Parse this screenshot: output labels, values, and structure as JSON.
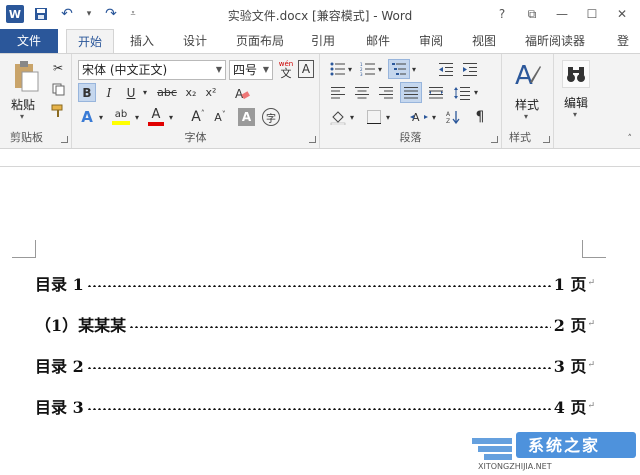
{
  "window": {
    "title": "实验文件.docx [兼容模式] - Word",
    "app_icon": "W",
    "help": "?",
    "restore": "⧉",
    "minimize": "—",
    "maximize": "☐",
    "close": "✕"
  },
  "tabs": [
    {
      "label": "文件"
    },
    {
      "label": "开始"
    },
    {
      "label": "插入"
    },
    {
      "label": "设计"
    },
    {
      "label": "页面布局"
    },
    {
      "label": "引用"
    },
    {
      "label": "邮件"
    },
    {
      "label": "审阅"
    },
    {
      "label": "视图"
    },
    {
      "label": "福昕阅读器"
    },
    {
      "label": "登"
    }
  ],
  "ribbon": {
    "clipboard": {
      "label": "剪贴板",
      "paste": "粘贴"
    },
    "font": {
      "label": "字体",
      "font_name": "宋体 (中文正文)",
      "font_size": "四号",
      "wen": "wén",
      "wen_char": "文",
      "bold": "B",
      "italic": "I",
      "underline": "U",
      "strike": "abc",
      "subscript": "x₂",
      "superscript": "x²",
      "text_effects": "A",
      "highlight": "ab",
      "font_color": "A",
      "grow": "A",
      "shrink": "A",
      "shading": "A",
      "enclose": "字"
    },
    "paragraph": {
      "label": "段落"
    },
    "styles": {
      "label": "样式",
      "button": "样式"
    },
    "editing": {
      "button": "编辑"
    }
  },
  "document": {
    "toc": [
      {
        "label": "目录 1",
        "page": "1 页"
      },
      {
        "label": "（1）某某某",
        "page": "2 页"
      },
      {
        "label": "目录 2",
        "page": "3 页"
      },
      {
        "label": "目录 3",
        "page": "4 页"
      }
    ],
    "para_mark": "↵"
  },
  "watermark": {
    "brand": "系统之家",
    "url": "XITONGZHIJIA.NET"
  },
  "colors": {
    "word_blue": "#2b579a",
    "highlight": "#ffff00",
    "font_red": "#e00000"
  }
}
